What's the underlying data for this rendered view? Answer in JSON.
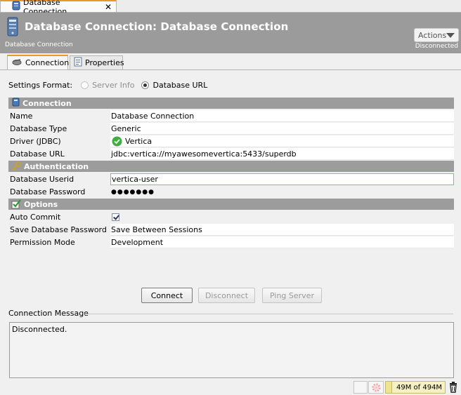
{
  "doc_tab": {
    "label": "Database Connection",
    "close": "✕"
  },
  "header": {
    "title": "Database Connection: Database Connection",
    "subtitle": "Database Connection",
    "status": "Disconnected",
    "actions_label": "Actions"
  },
  "subtabs": [
    {
      "label": "Connection",
      "icon": "connection-icon",
      "active": true
    },
    {
      "label": "Properties",
      "icon": "properties-icon",
      "active": false
    }
  ],
  "settings_format": {
    "label": "Settings Format:",
    "option_server_info": "Server Info",
    "option_database_url": "Database URL",
    "selected": "Database URL"
  },
  "sections": {
    "connection": "Connection",
    "authentication": "Authentication",
    "options": "Options"
  },
  "connection_rows": [
    {
      "label": "Name",
      "value": "Database Connection"
    },
    {
      "label": "Database Type",
      "value": "Generic"
    },
    {
      "label": "Driver (JDBC)",
      "value": "Vertica"
    },
    {
      "label": "Database URL",
      "value": "jdbc:vertica://myawesomevertica:5433/superdb"
    }
  ],
  "auth_rows": [
    {
      "label": "Database Userid",
      "value": "vertica-user"
    },
    {
      "label": "Database Password",
      "value": "●●●●●●●"
    }
  ],
  "option_rows": [
    {
      "label": "Auto Commit",
      "checked": true
    },
    {
      "label": "Save Database Password",
      "value": "Save Between Sessions"
    },
    {
      "label": "Permission Mode",
      "value": "Development"
    }
  ],
  "buttons": {
    "connect": "Connect",
    "disconnect": "Disconnect",
    "ping": "Ping Server"
  },
  "message": {
    "title": "Connection Message",
    "text": "Disconnected."
  },
  "status_bar": {
    "memory": "49M of 494M"
  },
  "colors": {
    "header_bg": "#9b9b9b",
    "section_bg": "#9c9c9c",
    "active_tab_accent": "#e79a2c",
    "success_green": "#3fae3f"
  }
}
